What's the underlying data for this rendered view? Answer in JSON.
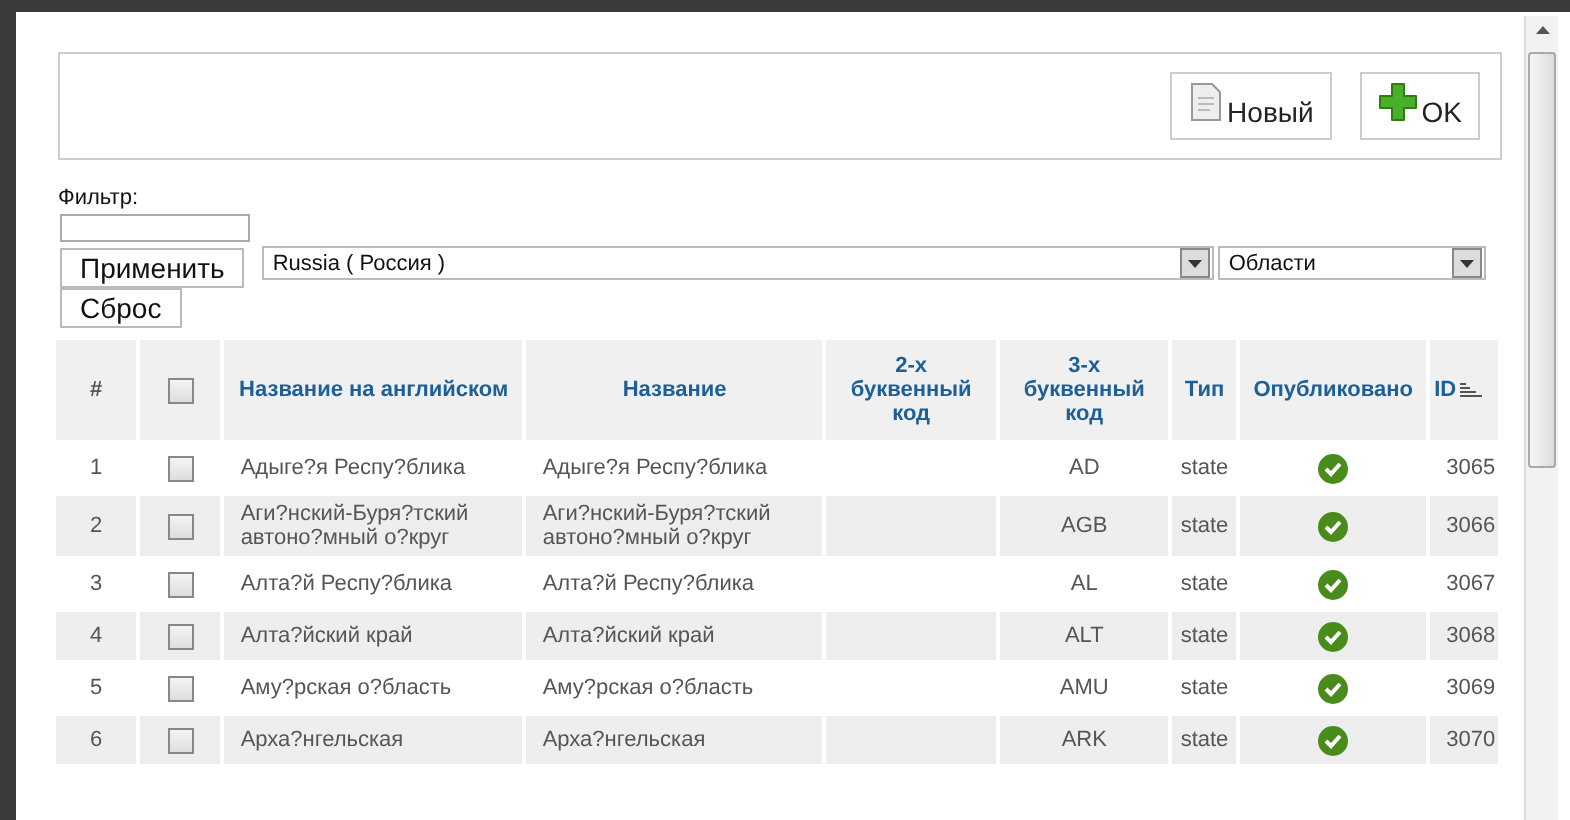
{
  "toolbar": {
    "buttons": [
      {
        "kind": "new",
        "label": "Новый"
      },
      {
        "kind": "ok",
        "label": "OK"
      }
    ]
  },
  "filter": {
    "label": "Фильтр:",
    "apply": "Применить",
    "reset": "Сброс",
    "country": "Russia ( Россия )",
    "region_type": "Области"
  },
  "table": {
    "columns": [
      "#",
      "Название на английском",
      "Название",
      "2-х буквенный код",
      "3-х буквенный код",
      "Тип",
      "Опубликовано",
      "ID"
    ],
    "header_checked": false,
    "rows": [
      {
        "num": "1",
        "checked": false,
        "name_en": "Адыге?я Респу?блика",
        "name": "Адыге?я Респу?блика",
        "code2": "",
        "code3": "AD",
        "type": "state",
        "published": true,
        "id": "3065"
      },
      {
        "num": "2",
        "checked": false,
        "name_en": "Аги?нский-Буря?тский автоно?мный о?круг",
        "name": "Аги?нский-Буря?тский автоно?мный о?круг",
        "code2": "",
        "code3": "AGB",
        "type": "state",
        "published": true,
        "id": "3066"
      },
      {
        "num": "3",
        "checked": false,
        "name_en": "Алта?й Респу?блика",
        "name": "Алта?й Респу?блика",
        "code2": "",
        "code3": "AL",
        "type": "state",
        "published": true,
        "id": "3067"
      },
      {
        "num": "4",
        "checked": false,
        "name_en": "Алта?йский край",
        "name": "Алта?йский край",
        "code2": "",
        "code3": "ALT",
        "type": "state",
        "published": true,
        "id": "3068"
      },
      {
        "num": "5",
        "checked": false,
        "name_en": "Аму?рская о?бласть",
        "name": "Аму?рская о?бласть",
        "code2": "",
        "code3": "AMU",
        "type": "state",
        "published": true,
        "id": "3069"
      },
      {
        "num": "6",
        "checked": false,
        "name_en": "Арха?нгельская",
        "name": "Арха?нгельская",
        "code2": "",
        "code3": "ARK",
        "type": "state",
        "published": true,
        "id": "3070"
      }
    ]
  }
}
